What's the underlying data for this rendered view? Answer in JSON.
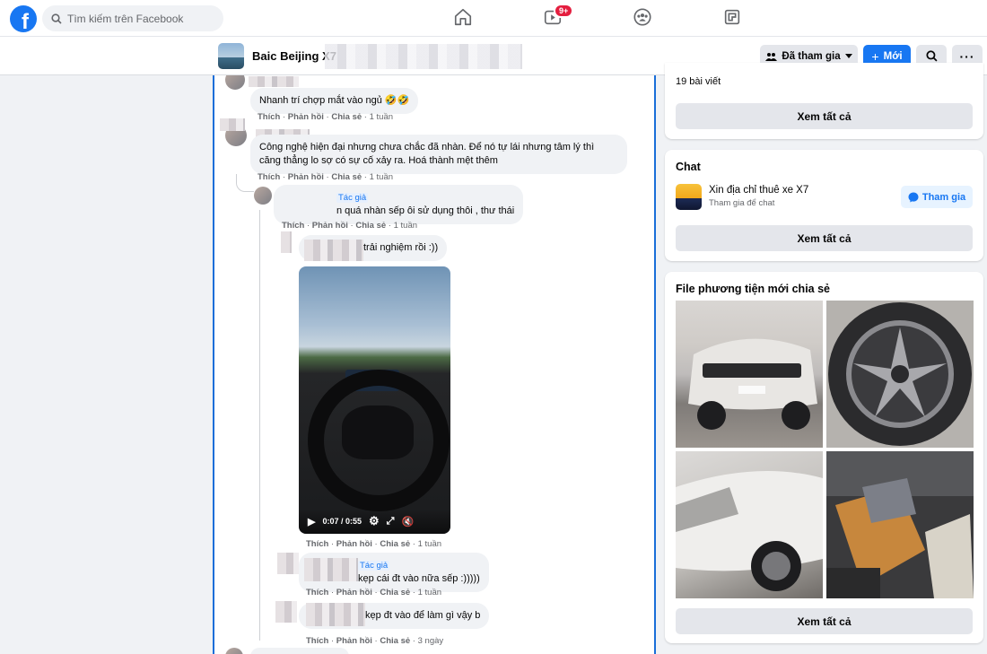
{
  "topbar": {
    "logo": "f",
    "search_placeholder": "Tìm kiếm trên Facebook",
    "video_badge": "9+"
  },
  "group": {
    "name": "Baic Beijing X7",
    "joined_label": "Đã tham gia",
    "new_label": "Mới"
  },
  "comments": {
    "c1": {
      "text": "Nhanh trí chợp mắt vào ngủ 🤣🤣",
      "like": "Thích",
      "reply": "Phản hồi",
      "share": "Chia sẻ",
      "time": "1 tuần"
    },
    "c2": {
      "text": "Công nghệ hiện đại nhưng chưa chắc đã nhàn. Để nó tự lái nhưng tâm lý thì căng thẳng lo sợ có sự cố xảy ra. Hoá thành mệt thêm",
      "like": "Thích",
      "reply": "Phản hồi",
      "share": "Chia sẻ",
      "time": "1 tuần"
    },
    "c3": {
      "author_badge": "Tác giả",
      "text": "n quá nhàn sếp ôi sử dụng thôi , thư thái",
      "like": "Thích",
      "reply": "Phản hồi",
      "share": "Chia sẻ",
      "time": "1 tuần"
    },
    "c4": {
      "text": "trải nghiệm rồi :))",
      "video_time": "0:07 / 0:55",
      "like": "Thích",
      "reply": "Phản hồi",
      "share": "Chia sẻ",
      "time": "1 tuần"
    },
    "c5": {
      "author_badge": "Tác giả",
      "text": "kẹp cái đt vào nữa sếp :)))))",
      "like": "Thích",
      "reply": "Phản hồi",
      "share": "Chia sẻ",
      "time": "1 tuần"
    },
    "c6": {
      "text": "kẹp đt vào để làm gì vậy b",
      "like": "Thích",
      "reply": "Phản hồi",
      "share": "Chia sẻ",
      "time": "3 ngày"
    }
  },
  "sidebar": {
    "posts_count": "19 bài viết",
    "see_all": "Xem tất cả",
    "chat_title": "Chat",
    "chat_name": "Xin địa chỉ thuê xe X7",
    "chat_sub": "Tham gia để chat",
    "join_label": "Tham gia",
    "media_title": "File phương tiện mới chia sẻ"
  },
  "colors": {
    "brand": "#1877f2",
    "badge": "#e41e3f"
  }
}
